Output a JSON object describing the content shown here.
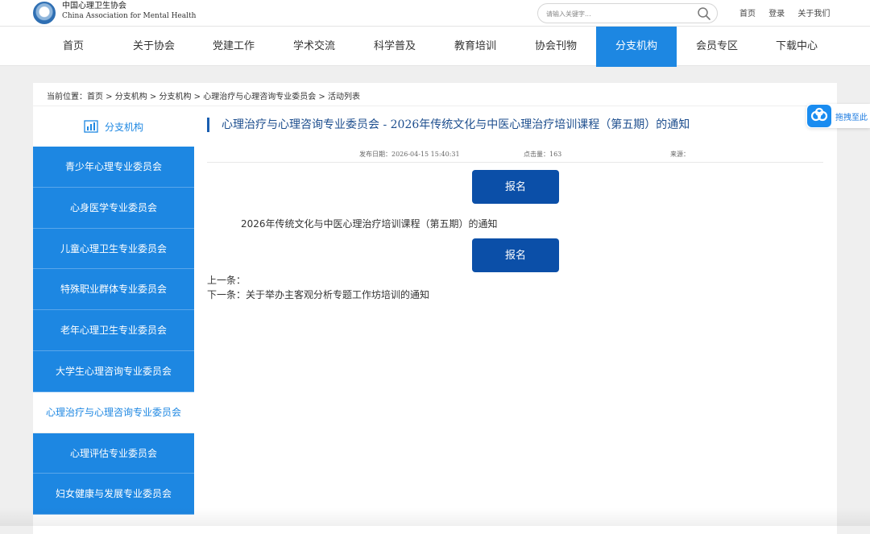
{
  "header": {
    "org_name_cn": "中国心理卫生协会",
    "org_name_en": "China Association for Mental Health",
    "search_placeholder": "请输入关键字...",
    "top_links": [
      "首页",
      "登录",
      "关于我们"
    ]
  },
  "nav": {
    "items": [
      "首页",
      "关于协会",
      "党建工作",
      "学术交流",
      "科学普及",
      "教育培训",
      "协会刊物",
      "分支机构",
      "会员专区",
      "下载中心"
    ],
    "active_index": 7
  },
  "breadcrumb": "当前位置：首页 > 分支机构 > 分支机构 > 心理治疗与心理咨询专业委员会 > 活动列表",
  "sidebar": {
    "heading": "分支机构",
    "items": [
      "青少年心理专业委员会",
      "心身医学专业委员会",
      "儿童心理卫生专业委员会",
      "特殊职业群体专业委员会",
      "老年心理卫生专业委员会",
      "大学生心理咨询专业委员会",
      "心理治疗与心理咨询专业委员会",
      "心理评估专业委员会",
      "妇女健康与发展专业委员会"
    ],
    "active_index": 6
  },
  "article": {
    "title": "心理治疗与心理咨询专业委员会 - 2026年传统文化与中医心理治疗培训课程（第五期）的通知",
    "publish_date": "发布日期：2026-04-15 15:40:31",
    "clicks": "点击量：163",
    "source": "来源：",
    "register_label": "报名",
    "body_text": "2026年传统文化与中医心理治疗培训课程（第五期）的通知",
    "prev": "上一条：",
    "next": "下一条：关于举办主客观分析专题工作坊培训的通知"
  },
  "float_widget": {
    "label": "拖拽至此"
  },
  "colors": {
    "nav_active": "#1d87e2",
    "sidebar": "#1d87e2",
    "button": "#0b4fa8",
    "title": "#1d4e8e"
  }
}
